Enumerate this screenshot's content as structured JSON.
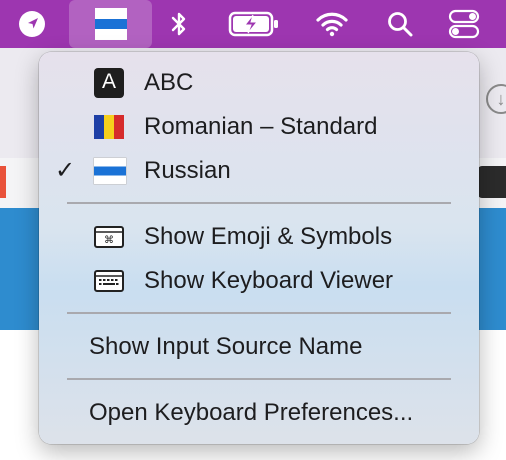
{
  "menubar": {
    "icons": [
      "location-arrow-icon",
      "russian-flag-icon",
      "bluetooth-icon",
      "battery-charging-icon",
      "wifi-icon",
      "search-icon",
      "control-center-icon"
    ]
  },
  "background": {
    "download_icon": "↓"
  },
  "input_menu": {
    "sources": [
      {
        "label": "ABC",
        "icon_text": "A",
        "icon": "abc-keyboard-icon",
        "checked": false
      },
      {
        "label": "Romanian – Standard",
        "icon": "romanian-flag-icon",
        "checked": false
      },
      {
        "label": "Russian",
        "icon": "russian-flag-icon",
        "checked": true
      }
    ],
    "check_mark": "✓",
    "show_emoji": "Show Emoji & Symbols",
    "show_keyboard_viewer": "Show Keyboard Viewer",
    "show_input_source_name": "Show Input Source Name",
    "open_keyboard_prefs": "Open Keyboard Preferences..."
  },
  "colors": {
    "menubar": "#9d36b0",
    "ru_blue": "#1a72d6",
    "ro_blue": "#1e3fa6",
    "ro_yellow": "#f6cf1c",
    "ro_red": "#d62b2b"
  }
}
